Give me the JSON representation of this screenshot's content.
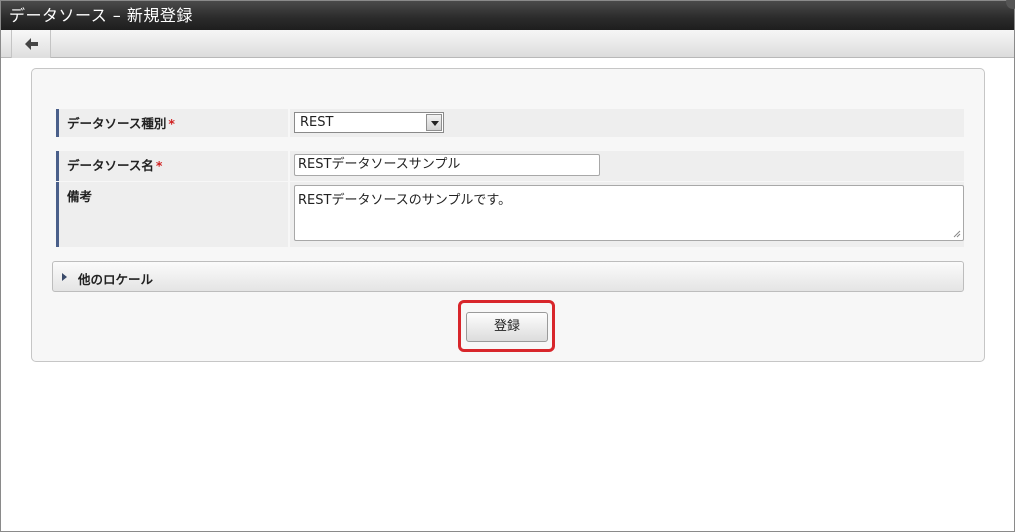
{
  "window": {
    "title": "データソース – 新規登録"
  },
  "toolbar": {
    "back_icon": "arrow-left-icon"
  },
  "form": {
    "type": {
      "label": "データソース種別",
      "required_mark": "*",
      "value": "REST"
    },
    "name": {
      "label": "データソース名",
      "required_mark": "*",
      "value": "RESTデータソースサンプル"
    },
    "note": {
      "label": "備考",
      "value": "RESTデータソースのサンプルです。"
    }
  },
  "locale_section": {
    "label": "他のロケール",
    "icon": "triangle-right-icon"
  },
  "actions": {
    "submit_label": "登録",
    "highlight_color": "#d8262b"
  }
}
